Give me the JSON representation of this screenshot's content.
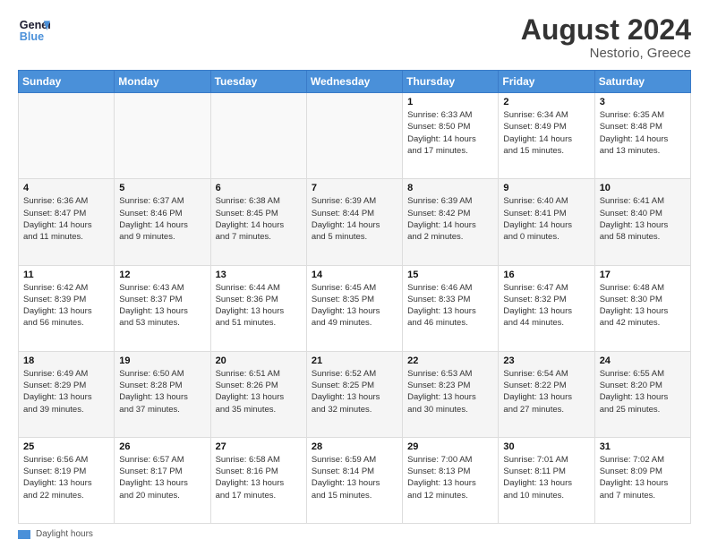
{
  "logo": {
    "line1": "General",
    "line2": "Blue"
  },
  "title": "August 2024",
  "location": "Nestorio, Greece",
  "days_header": [
    "Sunday",
    "Monday",
    "Tuesday",
    "Wednesday",
    "Thursday",
    "Friday",
    "Saturday"
  ],
  "legend_label": "Daylight hours",
  "weeks": [
    [
      {
        "day": "",
        "info": ""
      },
      {
        "day": "",
        "info": ""
      },
      {
        "day": "",
        "info": ""
      },
      {
        "day": "",
        "info": ""
      },
      {
        "day": "1",
        "info": "Sunrise: 6:33 AM\nSunset: 8:50 PM\nDaylight: 14 hours\nand 17 minutes."
      },
      {
        "day": "2",
        "info": "Sunrise: 6:34 AM\nSunset: 8:49 PM\nDaylight: 14 hours\nand 15 minutes."
      },
      {
        "day": "3",
        "info": "Sunrise: 6:35 AM\nSunset: 8:48 PM\nDaylight: 14 hours\nand 13 minutes."
      }
    ],
    [
      {
        "day": "4",
        "info": "Sunrise: 6:36 AM\nSunset: 8:47 PM\nDaylight: 14 hours\nand 11 minutes."
      },
      {
        "day": "5",
        "info": "Sunrise: 6:37 AM\nSunset: 8:46 PM\nDaylight: 14 hours\nand 9 minutes."
      },
      {
        "day": "6",
        "info": "Sunrise: 6:38 AM\nSunset: 8:45 PM\nDaylight: 14 hours\nand 7 minutes."
      },
      {
        "day": "7",
        "info": "Sunrise: 6:39 AM\nSunset: 8:44 PM\nDaylight: 14 hours\nand 5 minutes."
      },
      {
        "day": "8",
        "info": "Sunrise: 6:39 AM\nSunset: 8:42 PM\nDaylight: 14 hours\nand 2 minutes."
      },
      {
        "day": "9",
        "info": "Sunrise: 6:40 AM\nSunset: 8:41 PM\nDaylight: 14 hours\nand 0 minutes."
      },
      {
        "day": "10",
        "info": "Sunrise: 6:41 AM\nSunset: 8:40 PM\nDaylight: 13 hours\nand 58 minutes."
      }
    ],
    [
      {
        "day": "11",
        "info": "Sunrise: 6:42 AM\nSunset: 8:39 PM\nDaylight: 13 hours\nand 56 minutes."
      },
      {
        "day": "12",
        "info": "Sunrise: 6:43 AM\nSunset: 8:37 PM\nDaylight: 13 hours\nand 53 minutes."
      },
      {
        "day": "13",
        "info": "Sunrise: 6:44 AM\nSunset: 8:36 PM\nDaylight: 13 hours\nand 51 minutes."
      },
      {
        "day": "14",
        "info": "Sunrise: 6:45 AM\nSunset: 8:35 PM\nDaylight: 13 hours\nand 49 minutes."
      },
      {
        "day": "15",
        "info": "Sunrise: 6:46 AM\nSunset: 8:33 PM\nDaylight: 13 hours\nand 46 minutes."
      },
      {
        "day": "16",
        "info": "Sunrise: 6:47 AM\nSunset: 8:32 PM\nDaylight: 13 hours\nand 44 minutes."
      },
      {
        "day": "17",
        "info": "Sunrise: 6:48 AM\nSunset: 8:30 PM\nDaylight: 13 hours\nand 42 minutes."
      }
    ],
    [
      {
        "day": "18",
        "info": "Sunrise: 6:49 AM\nSunset: 8:29 PM\nDaylight: 13 hours\nand 39 minutes."
      },
      {
        "day": "19",
        "info": "Sunrise: 6:50 AM\nSunset: 8:28 PM\nDaylight: 13 hours\nand 37 minutes."
      },
      {
        "day": "20",
        "info": "Sunrise: 6:51 AM\nSunset: 8:26 PM\nDaylight: 13 hours\nand 35 minutes."
      },
      {
        "day": "21",
        "info": "Sunrise: 6:52 AM\nSunset: 8:25 PM\nDaylight: 13 hours\nand 32 minutes."
      },
      {
        "day": "22",
        "info": "Sunrise: 6:53 AM\nSunset: 8:23 PM\nDaylight: 13 hours\nand 30 minutes."
      },
      {
        "day": "23",
        "info": "Sunrise: 6:54 AM\nSunset: 8:22 PM\nDaylight: 13 hours\nand 27 minutes."
      },
      {
        "day": "24",
        "info": "Sunrise: 6:55 AM\nSunset: 8:20 PM\nDaylight: 13 hours\nand 25 minutes."
      }
    ],
    [
      {
        "day": "25",
        "info": "Sunrise: 6:56 AM\nSunset: 8:19 PM\nDaylight: 13 hours\nand 22 minutes."
      },
      {
        "day": "26",
        "info": "Sunrise: 6:57 AM\nSunset: 8:17 PM\nDaylight: 13 hours\nand 20 minutes."
      },
      {
        "day": "27",
        "info": "Sunrise: 6:58 AM\nSunset: 8:16 PM\nDaylight: 13 hours\nand 17 minutes."
      },
      {
        "day": "28",
        "info": "Sunrise: 6:59 AM\nSunset: 8:14 PM\nDaylight: 13 hours\nand 15 minutes."
      },
      {
        "day": "29",
        "info": "Sunrise: 7:00 AM\nSunset: 8:13 PM\nDaylight: 13 hours\nand 12 minutes."
      },
      {
        "day": "30",
        "info": "Sunrise: 7:01 AM\nSunset: 8:11 PM\nDaylight: 13 hours\nand 10 minutes."
      },
      {
        "day": "31",
        "info": "Sunrise: 7:02 AM\nSunset: 8:09 PM\nDaylight: 13 hours\nand 7 minutes."
      }
    ]
  ]
}
